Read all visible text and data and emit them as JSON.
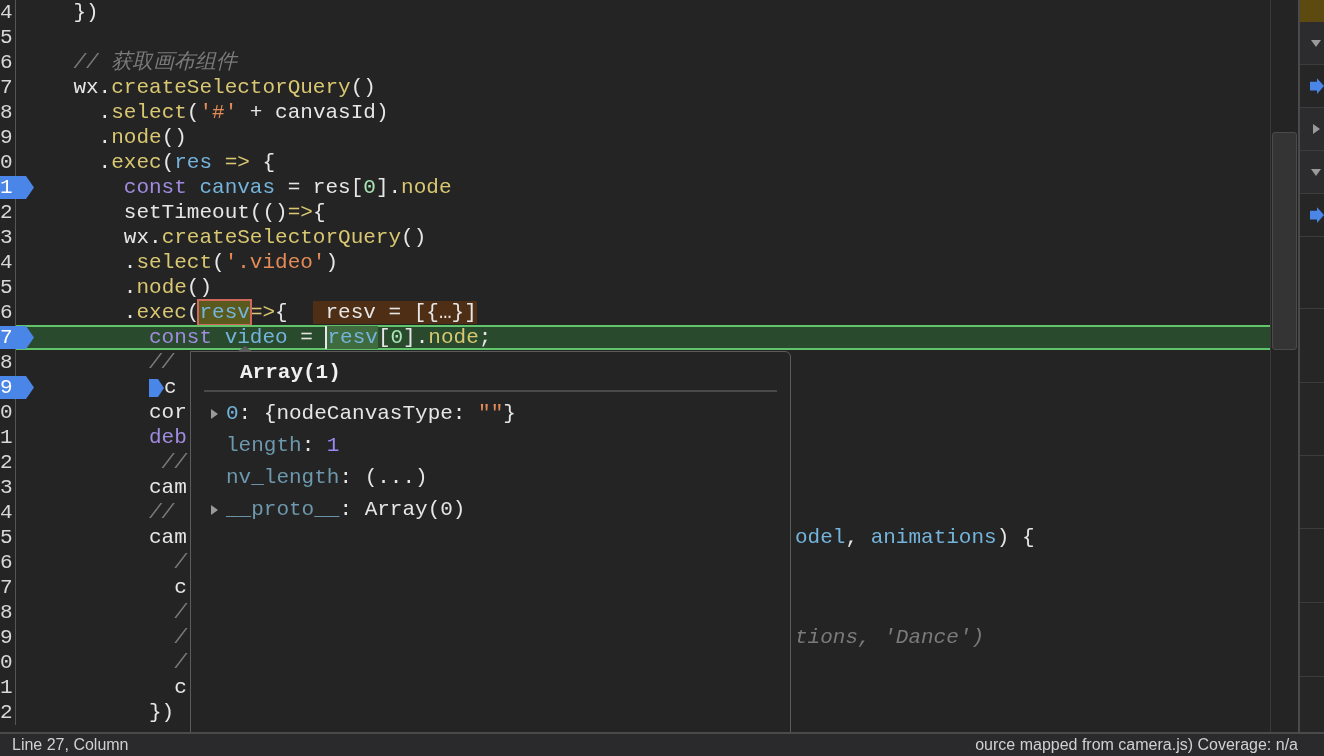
{
  "code_lines": [
    {
      "number": "4",
      "breakpoint": false,
      "current": false,
      "tokens": [
        {
          "text": "    })",
          "kind": "plain"
        }
      ]
    },
    {
      "number": "5",
      "breakpoint": false,
      "current": false
    },
    {
      "number": "6",
      "breakpoint": false,
      "current": false,
      "tokens": [
        {
          "text": "    // 获取画布组件",
          "kind": "comment"
        }
      ]
    },
    {
      "number": "7",
      "breakpoint": false,
      "current": false,
      "tokens": [
        {
          "text": "    wx.",
          "kind": "plain"
        },
        {
          "text": "createSelectorQuery",
          "kind": "fn"
        },
        {
          "text": "()",
          "kind": "plain"
        }
      ]
    },
    {
      "number": "8",
      "breakpoint": false,
      "current": false,
      "tokens": [
        {
          "text": "      .",
          "kind": "plain"
        },
        {
          "text": "select",
          "kind": "fn"
        },
        {
          "text": "(",
          "kind": "plain"
        },
        {
          "text": "'#'",
          "kind": "str"
        },
        {
          "text": " + canvasId)",
          "kind": "plain"
        }
      ]
    },
    {
      "number": "9",
      "breakpoint": false,
      "current": false,
      "tokens": [
        {
          "text": "      .",
          "kind": "plain"
        },
        {
          "text": "node",
          "kind": "fn"
        },
        {
          "text": "()",
          "kind": "plain"
        }
      ]
    },
    {
      "number": "0",
      "breakpoint": false,
      "current": false,
      "tokens": [
        {
          "text": "      .",
          "kind": "plain"
        },
        {
          "text": "exec",
          "kind": "fn"
        },
        {
          "text": "(",
          "kind": "plain"
        },
        {
          "text": "res ",
          "kind": "var"
        },
        {
          "text": "=>",
          "kind": "fn"
        },
        {
          "text": " {",
          "kind": "plain"
        }
      ]
    },
    {
      "number": "1",
      "breakpoint": true,
      "current": false,
      "tokens": [
        {
          "text": "        const ",
          "kind": "kw"
        },
        {
          "text": "canvas",
          "kind": "var"
        },
        {
          "text": " = res[",
          "kind": "plain"
        },
        {
          "text": "0",
          "kind": "num"
        },
        {
          "text": "].",
          "kind": "plain"
        },
        {
          "text": "node",
          "kind": "fn"
        }
      ]
    },
    {
      "number": "2",
      "breakpoint": false,
      "current": false,
      "tokens": [
        {
          "text": "        setTimeout(()",
          "kind": "plain"
        },
        {
          "text": "=>",
          "kind": "fn"
        },
        {
          "text": "{",
          "kind": "plain"
        }
      ]
    },
    {
      "number": "3",
      "breakpoint": false,
      "current": false,
      "tokens": [
        {
          "text": "        wx.",
          "kind": "plain"
        },
        {
          "text": "createSelectorQuery",
          "kind": "fn"
        },
        {
          "text": "()",
          "kind": "plain"
        }
      ]
    },
    {
      "number": "4",
      "breakpoint": false,
      "current": false,
      "tokens": [
        {
          "text": "        .",
          "kind": "plain"
        },
        {
          "text": "select",
          "kind": "fn"
        },
        {
          "text": "(",
          "kind": "plain"
        },
        {
          "text": "'.video'",
          "kind": "str"
        },
        {
          "text": ")",
          "kind": "plain"
        }
      ]
    },
    {
      "number": "5",
      "breakpoint": false,
      "current": false,
      "tokens": [
        {
          "text": "        .",
          "kind": "plain"
        },
        {
          "text": "node",
          "kind": "fn"
        },
        {
          "text": "()",
          "kind": "plain"
        }
      ]
    },
    {
      "number": "6",
      "breakpoint": false,
      "current": false,
      "tokens": [
        {
          "text": "        .",
          "kind": "plain"
        },
        {
          "text": "exec",
          "kind": "fn"
        },
        {
          "text": "(",
          "kind": "plain"
        },
        {
          "text": "resv",
          "kind": "hover"
        },
        {
          "text": "=>",
          "kind": "fn"
        },
        {
          "text": "{  ",
          "kind": "plain"
        },
        {
          "text": " resv = [{…}]",
          "kind": "inline"
        }
      ]
    },
    {
      "number": "7",
      "breakpoint": true,
      "current": true,
      "tokens": [
        {
          "text": "          const ",
          "kind": "kw"
        },
        {
          "text": "video",
          "kind": "var"
        },
        {
          "text": " = ",
          "kind": "plain"
        },
        {
          "text": "resv",
          "kind": "match"
        },
        {
          "text": "[",
          "kind": "plain"
        },
        {
          "text": "0",
          "kind": "num"
        },
        {
          "text": "].",
          "kind": "plain"
        },
        {
          "text": "node",
          "kind": "fn"
        },
        {
          "text": ";",
          "kind": "plain"
        }
      ]
    },
    {
      "number": "8",
      "breakpoint": false,
      "current": false,
      "tokens": [
        {
          "text": "          //",
          "kind": "comment"
        }
      ]
    },
    {
      "number": "9",
      "breakpoint": true,
      "current": false,
      "inline_breakpoint": true,
      "tokens": [
        {
          "text": "c",
          "kind": "plain"
        }
      ]
    },
    {
      "number": "0",
      "breakpoint": false,
      "current": false,
      "tokens": [
        {
          "text": "          cor",
          "kind": "plain"
        }
      ]
    },
    {
      "number": "1",
      "breakpoint": false,
      "current": false,
      "tokens": [
        {
          "text": "          deb",
          "kind": "kw"
        }
      ]
    },
    {
      "number": "2",
      "breakpoint": false,
      "current": false,
      "tokens": [
        {
          "text": "           //",
          "kind": "comment"
        }
      ]
    },
    {
      "number": "3",
      "breakpoint": false,
      "current": false,
      "tokens": [
        {
          "text": "          cam",
          "kind": "plain"
        }
      ]
    },
    {
      "number": "4",
      "breakpoint": false,
      "current": false,
      "tokens": [
        {
          "text": "          //",
          "kind": "comment"
        }
      ]
    },
    {
      "number": "5",
      "breakpoint": false,
      "current": false,
      "tokens": [
        {
          "text": "          cam",
          "kind": "plain"
        }
      ],
      "right_tokens": [
        {
          "text": "odel",
          "kind": "var"
        },
        {
          "text": ", ",
          "kind": "plain"
        },
        {
          "text": "animations",
          "kind": "var"
        },
        {
          "text": ") {",
          "kind": "plain"
        }
      ]
    },
    {
      "number": "6",
      "breakpoint": false,
      "current": false,
      "tokens": [
        {
          "text": "            /",
          "kind": "comment"
        }
      ]
    },
    {
      "number": "7",
      "breakpoint": false,
      "current": false,
      "tokens": [
        {
          "text": "            c",
          "kind": "plain"
        }
      ]
    },
    {
      "number": "8",
      "breakpoint": false,
      "current": false,
      "tokens": [
        {
          "text": "            /",
          "kind": "comment"
        }
      ]
    },
    {
      "number": "9",
      "breakpoint": false,
      "current": false,
      "tokens": [
        {
          "text": "            /",
          "kind": "comment"
        }
      ],
      "right_tokens": [
        {
          "text": "tions, 'Dance')",
          "kind": "comment"
        }
      ]
    },
    {
      "number": "0",
      "breakpoint": false,
      "current": false,
      "tokens": [
        {
          "text": "            /",
          "kind": "comment"
        }
      ]
    },
    {
      "number": "1",
      "breakpoint": false,
      "current": false,
      "tokens": [
        {
          "text": "            c",
          "kind": "plain"
        }
      ]
    },
    {
      "number": "2",
      "breakpoint": false,
      "current": false,
      "tokens": [
        {
          "text": "          })",
          "kind": "plain"
        }
      ]
    }
  ],
  "popover": {
    "title": "Array(1)",
    "entries": [
      {
        "expandable": true,
        "tokens": [
          {
            "text": "0",
            "kind": "var"
          },
          {
            "text": ": {nodeCanvasType: ",
            "kind": "plain"
          },
          {
            "text": "\"\"",
            "kind": "str"
          },
          {
            "text": "}",
            "kind": "plain"
          }
        ]
      },
      {
        "expandable": false,
        "tokens": [
          {
            "text": "length",
            "kind": "prop"
          },
          {
            "text": ": ",
            "kind": "plain"
          },
          {
            "text": "1",
            "kind": "numval"
          }
        ]
      },
      {
        "expandable": false,
        "tokens": [
          {
            "text": "nv_length",
            "kind": "prop"
          },
          {
            "text": ": (...)",
            "kind": "plain"
          }
        ]
      },
      {
        "expandable": true,
        "tokens": [
          {
            "text": "__proto__",
            "kind": "prop"
          },
          {
            "text": ": Array(0)",
            "kind": "plain"
          }
        ]
      }
    ]
  },
  "sidebar": {
    "rows": [
      {
        "kind": "section",
        "expanded": true
      },
      {
        "kind": "breakpoint"
      },
      {
        "kind": "section",
        "expanded": false
      },
      {
        "kind": "section",
        "expanded": true
      },
      {
        "kind": "breakpoint"
      }
    ]
  },
  "status_bar": {
    "left": "Line 27, Column",
    "right": "ource mapped from camera.js) Coverage: n/a"
  }
}
